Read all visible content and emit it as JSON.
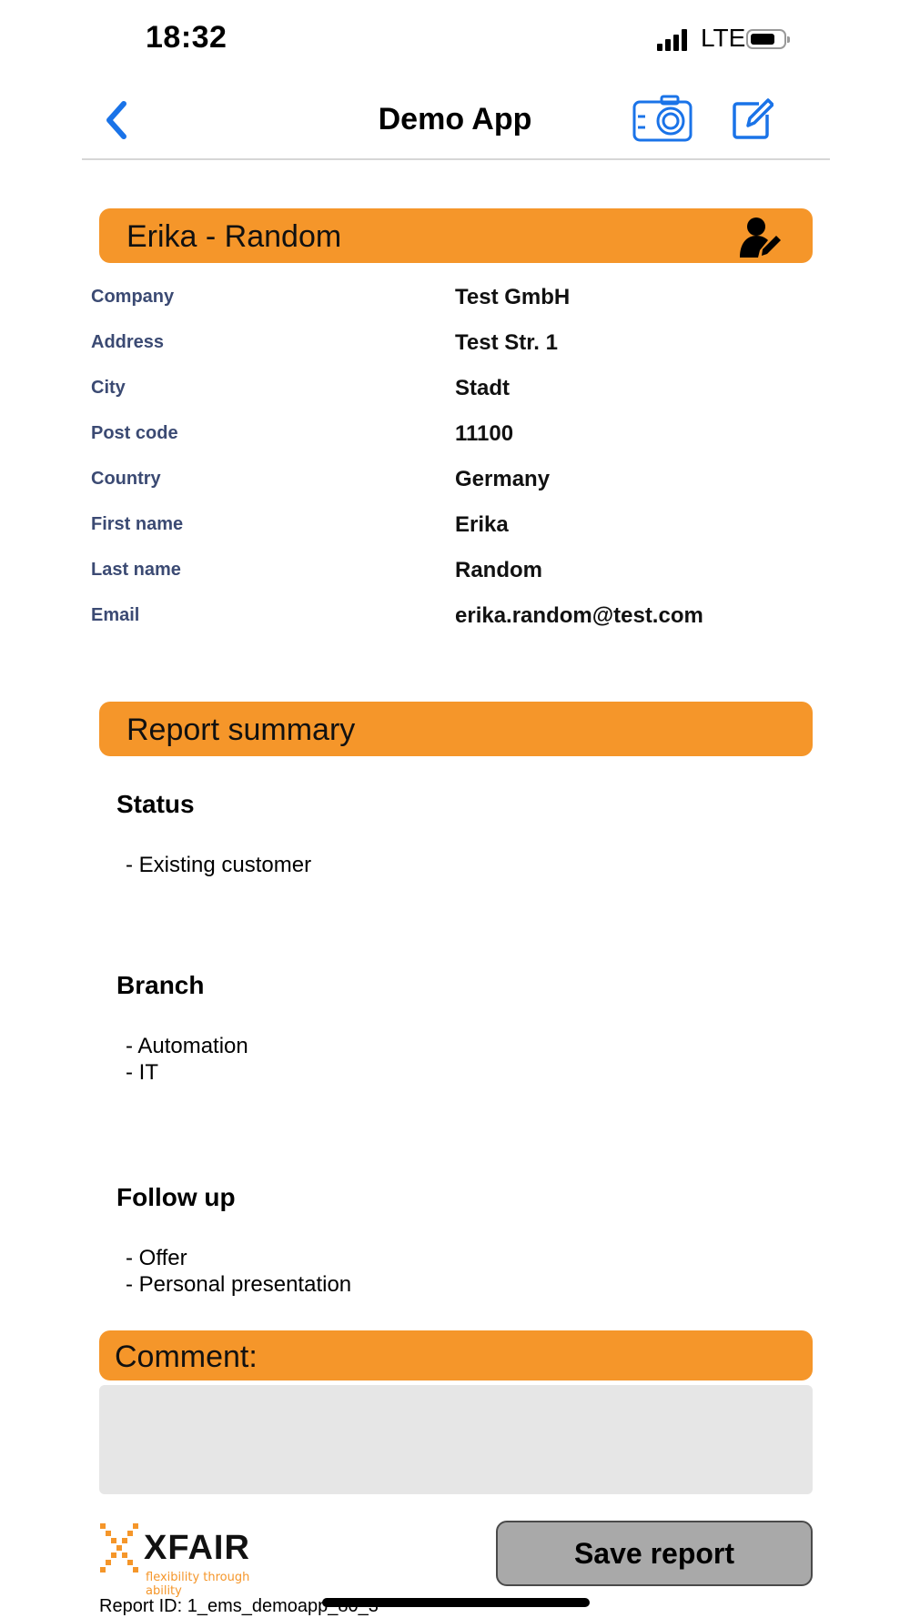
{
  "status_bar": {
    "time": "18:32",
    "network": "LTE"
  },
  "nav": {
    "title": "Demo App"
  },
  "contact": {
    "header": "Erika - Random",
    "rows": [
      {
        "label": "Company",
        "value": "Test GmbH"
      },
      {
        "label": "Address",
        "value": "Test Str. 1"
      },
      {
        "label": "City",
        "value": "Stadt"
      },
      {
        "label": "Post code",
        "value": "11100"
      },
      {
        "label": "Country",
        "value": "Germany"
      },
      {
        "label": "First name",
        "value": "Erika"
      },
      {
        "label": "Last name",
        "value": "Random"
      },
      {
        "label": "Email",
        "value": "erika.random@test.com"
      }
    ]
  },
  "summary": {
    "header": "Report summary",
    "groups": [
      {
        "title": "Status",
        "items": [
          "- Existing customer"
        ]
      },
      {
        "title": "Branch",
        "items": [
          "- Automation",
          "- IT"
        ]
      },
      {
        "title": "Follow up",
        "items": [
          "- Offer",
          "- Personal presentation"
        ]
      }
    ]
  },
  "comment": {
    "header": "Comment:",
    "value": ""
  },
  "footer": {
    "logo_text": "XFAIR",
    "logo_tagline": "flexibility through ability",
    "save_label": "Save report",
    "report_id": "Report ID: 1_ems_demoapp_80_3"
  },
  "colors": {
    "accent": "#f5962a",
    "label": "#3b4a73",
    "ios_blue": "#1a73e8"
  },
  "icons": [
    "back-chevron-icon",
    "camera-icon",
    "edit-icon",
    "person-edit-icon",
    "xfair-logo-icon"
  ]
}
